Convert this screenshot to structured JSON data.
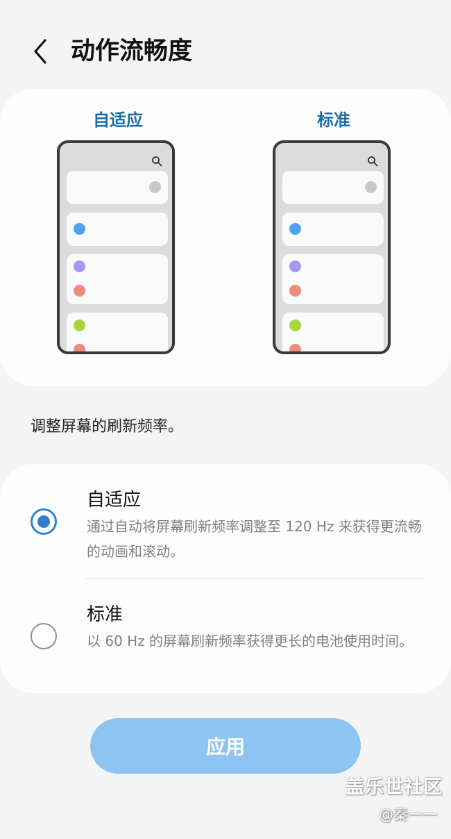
{
  "header": {
    "back_icon": "chevron-left-icon",
    "title": "动作流畅度"
  },
  "preview": {
    "adaptive_label": "自适应",
    "standard_label": "标准",
    "search_icon": "search-icon",
    "dot_colors": {
      "gray": "#c8c8c8",
      "blue": "#4da3f0",
      "purple": "#a39af0",
      "red": "#f08a7a",
      "green": "#a6d63c"
    }
  },
  "description": "调整屏幕的刷新频率。",
  "options": [
    {
      "title": "自适应",
      "description": "通过自动将屏幕刷新频率调整至 120 Hz 来获得更流畅的动画和滚动。",
      "selected": true
    },
    {
      "title": "标准",
      "description": "以 60 Hz 的屏幕刷新频率获得更长的电池使用时间。",
      "selected": false
    }
  ],
  "apply_button": {
    "label": "应用",
    "color": "#8ec4f1"
  },
  "accent_color": "#2d7fd6",
  "watermark": {
    "brand": "盖乐世社区",
    "user": "@秦一一"
  }
}
